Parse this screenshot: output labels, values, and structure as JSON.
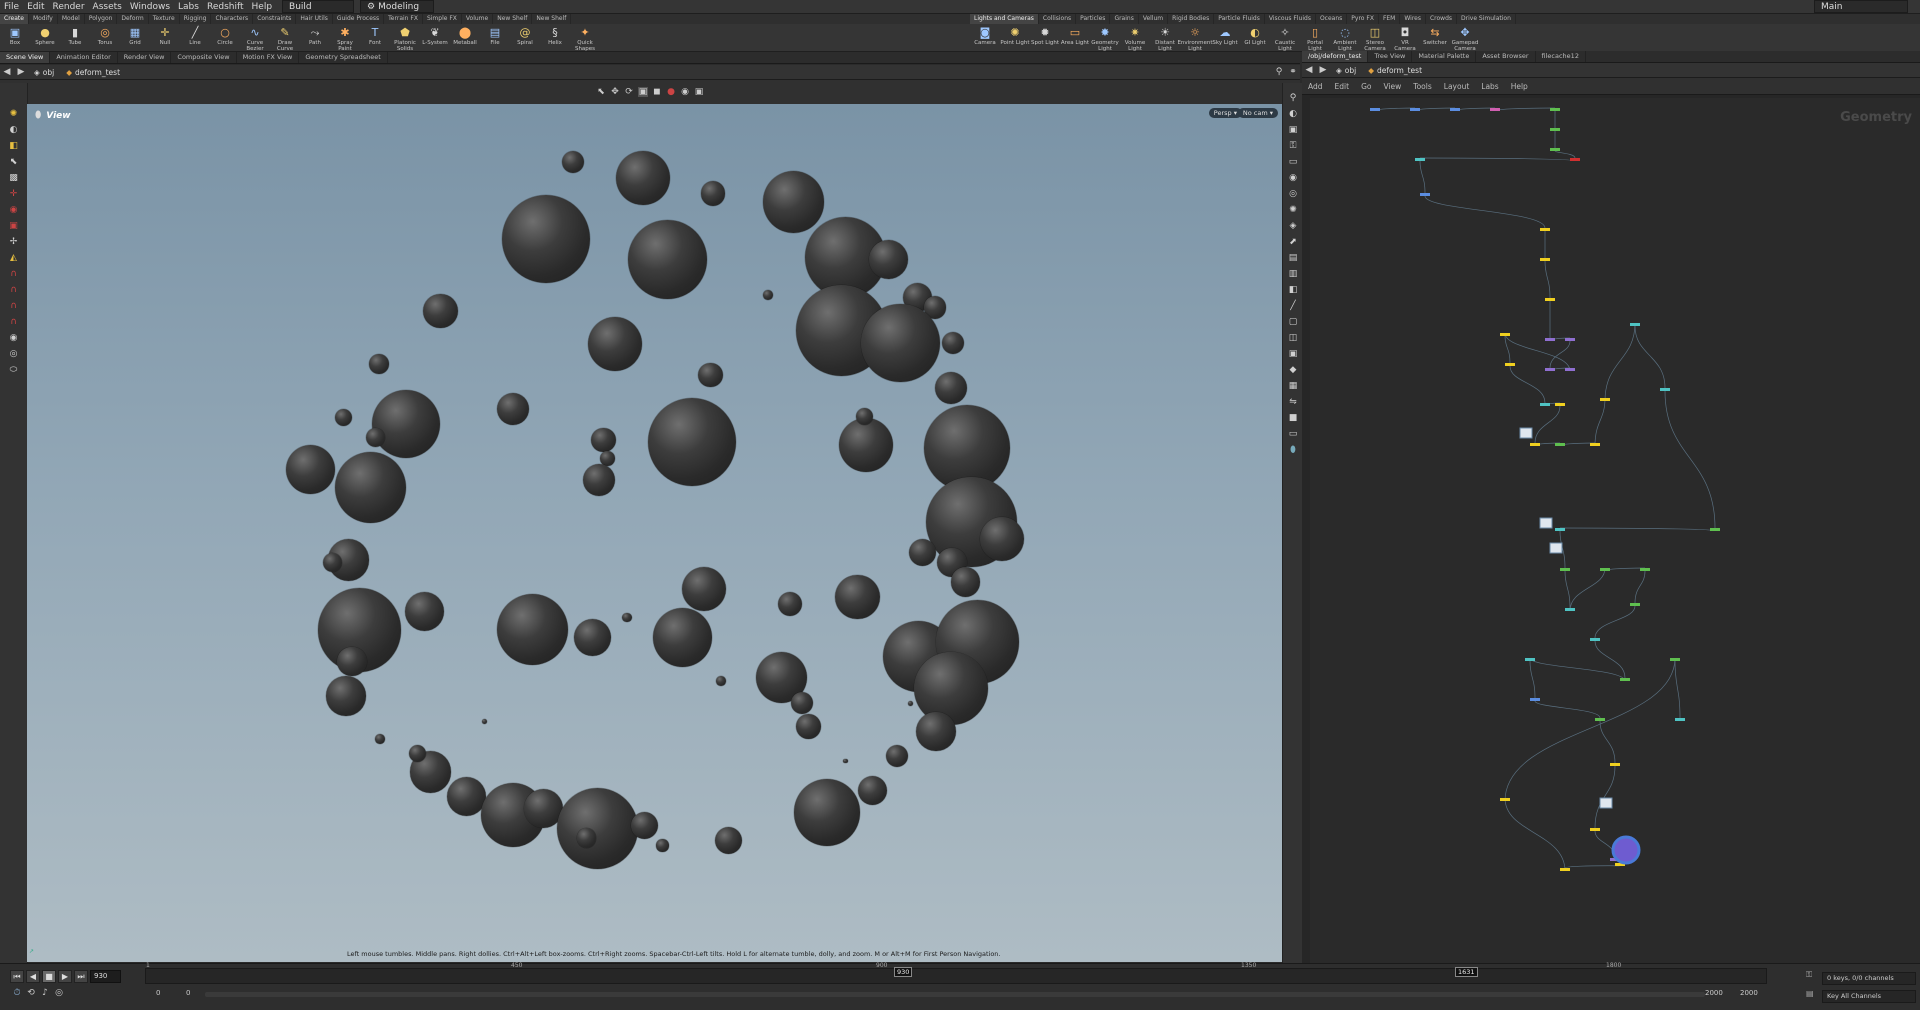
{
  "menus": [
    "File",
    "Edit",
    "Render",
    "Assets",
    "Windows",
    "Labs",
    "Redshift",
    "Help"
  ],
  "desktop": {
    "build_label": "Build",
    "mode_label": "Modeling",
    "main_label": "Main"
  },
  "shelf_tabs_left": [
    "Create",
    "Modify",
    "Model",
    "Polygon",
    "Deform",
    "Texture",
    "Rigging",
    "Characters",
    "Constraints",
    "Hair Utils",
    "Guide Process",
    "Terrain FX",
    "Simple FX",
    "Volume",
    "New Shelf",
    "New Shelf"
  ],
  "shelf_tabs_right": [
    "Lights and Cameras",
    "Collisions",
    "Particles",
    "Grains",
    "Vellum",
    "Rigid Bodies",
    "Particle Fluids",
    "Viscous Fluids",
    "Oceans",
    "Pyro FX",
    "FEM",
    "Wires",
    "Crowds",
    "Drive Simulation"
  ],
  "tools_left": [
    {
      "label": "Box",
      "icon": "box-icon",
      "glyph": "▣"
    },
    {
      "label": "Sphere",
      "icon": "sphere-icon",
      "glyph": "●"
    },
    {
      "label": "Tube",
      "icon": "tube-icon",
      "glyph": "▮"
    },
    {
      "label": "Torus",
      "icon": "torus-icon",
      "glyph": "◎"
    },
    {
      "label": "Grid",
      "icon": "grid-icon",
      "glyph": "▦"
    },
    {
      "label": "Null",
      "icon": "null-icon",
      "glyph": "✛"
    },
    {
      "label": "Line",
      "icon": "line-icon",
      "glyph": "╱"
    },
    {
      "label": "Circle",
      "icon": "circle-icon",
      "glyph": "○"
    },
    {
      "label": "Curve Bezier",
      "icon": "curve-bezier-icon",
      "glyph": "∿"
    },
    {
      "label": "Draw Curve",
      "icon": "draw-curve-icon",
      "glyph": "✎"
    },
    {
      "label": "Path",
      "icon": "path-icon",
      "glyph": "⤳"
    },
    {
      "label": "Spray Paint",
      "icon": "spray-paint-icon",
      "glyph": "✱"
    },
    {
      "label": "Font",
      "icon": "font-icon",
      "glyph": "T"
    },
    {
      "label": "Platonic Solids",
      "icon": "platonic-icon",
      "glyph": "⬟"
    },
    {
      "label": "L-System",
      "icon": "lsystem-icon",
      "glyph": "❦"
    },
    {
      "label": "Metaball",
      "icon": "metaball-icon",
      "glyph": "⬤"
    },
    {
      "label": "File",
      "icon": "file-icon",
      "glyph": "▤"
    },
    {
      "label": "Spiral",
      "icon": "spiral-icon",
      "glyph": "@"
    },
    {
      "label": "Helix",
      "icon": "helix-icon",
      "glyph": "§"
    },
    {
      "label": "Quick Shapes",
      "icon": "quick-shapes-icon",
      "glyph": "✦"
    }
  ],
  "tools_right": [
    {
      "label": "Camera",
      "icon": "camera-icon",
      "glyph": "◙"
    },
    {
      "label": "Point Light",
      "icon": "point-light-icon",
      "glyph": "✺"
    },
    {
      "label": "Spot Light",
      "icon": "spot-light-icon",
      "glyph": "✹"
    },
    {
      "label": "Area Light",
      "icon": "area-light-icon",
      "glyph": "▭"
    },
    {
      "label": "Geometry Light",
      "icon": "geometry-light-icon",
      "glyph": "✸"
    },
    {
      "label": "Volume Light",
      "icon": "volume-light-icon",
      "glyph": "✷"
    },
    {
      "label": "Distant Light",
      "icon": "distant-light-icon",
      "glyph": "☀"
    },
    {
      "label": "Environment Light",
      "icon": "environment-light-icon",
      "glyph": "☼"
    },
    {
      "label": "Sky Light",
      "icon": "sky-light-icon",
      "glyph": "☁"
    },
    {
      "label": "GI Light",
      "icon": "gi-light-icon",
      "glyph": "◐"
    },
    {
      "label": "Caustic Light",
      "icon": "caustic-light-icon",
      "glyph": "✧"
    },
    {
      "label": "Portal Light",
      "icon": "portal-light-icon",
      "glyph": "▯"
    },
    {
      "label": "Ambient Light",
      "icon": "ambient-light-icon",
      "glyph": "◌"
    },
    {
      "label": "Stereo Camera",
      "icon": "stereo-camera-icon",
      "glyph": "◫"
    },
    {
      "label": "VR Camera",
      "icon": "vr-camera-icon",
      "glyph": "◘"
    },
    {
      "label": "Switcher",
      "icon": "switcher-icon",
      "glyph": "⇆"
    },
    {
      "label": "Gamepad Camera",
      "icon": "gamepad-camera-icon",
      "glyph": "✥"
    }
  ],
  "left_tabs": [
    "Scene View",
    "Animation Editor",
    "Render View",
    "Composite View",
    "Motion FX View",
    "Geometry Spreadsheet"
  ],
  "right_tabs": [
    "/obj/deform_test",
    "Tree View",
    "Material Palette",
    "Asset Browser",
    "filecache12"
  ],
  "left_path": {
    "root": "obj",
    "node": "deform_test"
  },
  "right_path": {
    "root": "obj",
    "node": "deform_test"
  },
  "viewport": {
    "title": "View",
    "persp": "Persp ▾",
    "cam": "No cam ▾",
    "hint": "Left mouse tumbles. Middle pans. Right dollies. Ctrl+Alt+Left box-zooms. Ctrl+Right zooms. Spacebar-Ctrl-Left tilts. Hold L for alternate tumble, dolly, and zoom. M or Alt+M for First Person Navigation."
  },
  "network_menu": [
    "Add",
    "Edit",
    "Go",
    "View",
    "Tools",
    "Layout",
    "Labs",
    "Help"
  ],
  "network_label": "Geometry",
  "timeline": {
    "current_frame": "930",
    "start": "0",
    "start2": "0",
    "end": "2000",
    "end2": "2000",
    "frame_marker": "930",
    "marker2": "1631",
    "ticks": [
      "1",
      "450",
      "900",
      "1350",
      "1800"
    ],
    "keys": "0 keys, 0/0 channels",
    "key_all": "Key All Channels"
  },
  "colors": {
    "accent": "#f0d020",
    "node_green": "#5fbf4f",
    "node_cyan": "#4fc3c3",
    "node_blue": "#5b8de0",
    "node_purple": "#8f6fd0",
    "node_pink": "#d05fb0",
    "node_red": "#d03030"
  }
}
